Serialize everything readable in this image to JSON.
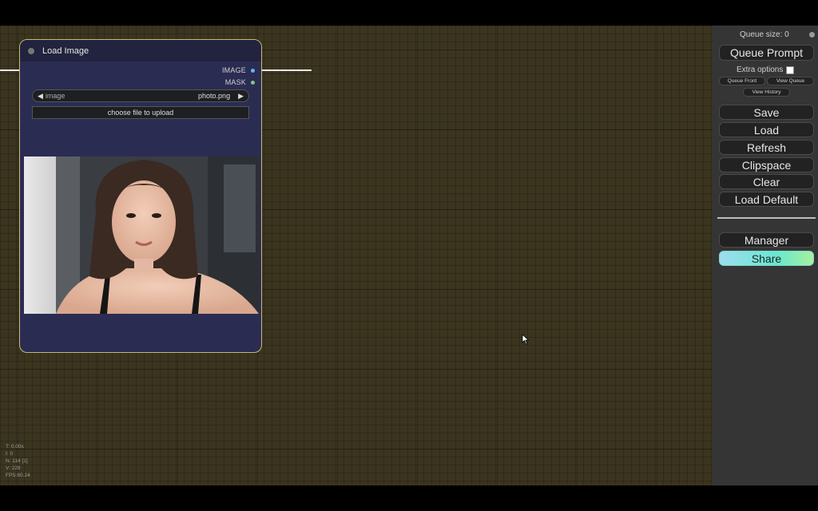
{
  "canvas": {
    "node": {
      "title": "Load Image",
      "outputs": [
        {
          "label": "IMAGE",
          "color": "#64b5f6"
        },
        {
          "label": "MASK",
          "color": "#81c784"
        }
      ],
      "image_widget": {
        "name": "image",
        "value": "photo.png",
        "left_arrow": "◀",
        "right_arrow": "▶"
      },
      "upload_label": "choose file to upload"
    },
    "stats": {
      "t": "T: 0.00s",
      "i": "I: 0",
      "n": "N: 114 [1]",
      "v": "V: 229",
      "fps": "FPS:60.24"
    }
  },
  "menu": {
    "queue_size": "Queue size: 0",
    "queue_prompt": "Queue Prompt",
    "extra_options": "Extra options",
    "queue_front": "Queue Front",
    "view_queue": "View Queue",
    "view_history": "View History",
    "save": "Save",
    "load": "Load",
    "refresh": "Refresh",
    "clipspace": "Clipspace",
    "clear": "Clear",
    "load_default": "Load Default",
    "manager": "Manager",
    "share": "Share"
  },
  "colors": {
    "canvas_bg": "#3b3520",
    "node_bg": "#2b2c52",
    "node_border": "#c9b97a",
    "menu_bg": "#353535"
  }
}
